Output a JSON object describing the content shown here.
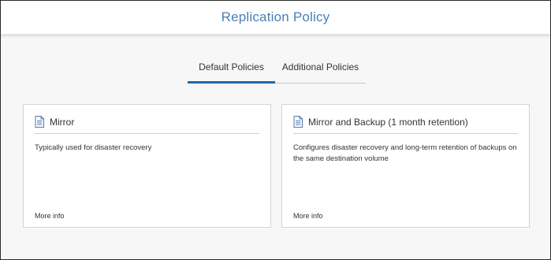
{
  "header": {
    "title": "Replication Policy"
  },
  "tabs": [
    {
      "label": "Default Policies",
      "active": true
    },
    {
      "label": "Additional Policies",
      "active": false
    }
  ],
  "policies": [
    {
      "icon": "document-icon",
      "title": "Mirror",
      "description": "Typically used for disaster recovery",
      "more_label": "More info"
    },
    {
      "icon": "document-icon",
      "title": "Mirror and Backup (1 month retention)",
      "description": "Configures disaster recovery and long-term retention of backups on the same destination volume",
      "more_label": "More info"
    }
  ],
  "colors": {
    "title": "#4a7fb5",
    "active_tab": "#1e6aa8",
    "icon": "#4f7ab0",
    "background": "#f7f7f7"
  }
}
